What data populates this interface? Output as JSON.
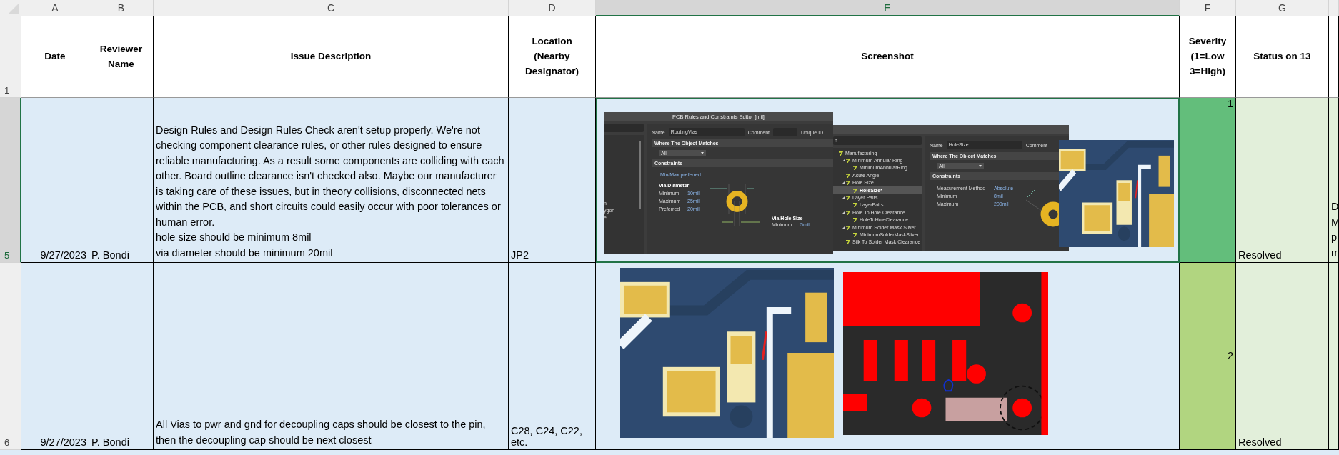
{
  "columns": [
    {
      "letter": "A",
      "selected": false
    },
    {
      "letter": "B",
      "selected": false
    },
    {
      "letter": "C",
      "selected": false
    },
    {
      "letter": "D",
      "selected": false
    },
    {
      "letter": "E",
      "selected": true
    },
    {
      "letter": "F",
      "selected": false
    },
    {
      "letter": "G",
      "selected": false
    }
  ],
  "header_row": {
    "number": "1",
    "cells": [
      "Date",
      "Reviewer Name",
      "Issue Description",
      "Location (Nearby Designator)",
      "Screenshot",
      "Severity (1=Low 3=High)",
      "Status on 13"
    ]
  },
  "rows": [
    {
      "number": "5",
      "selected": true,
      "date": "9/27/2023",
      "reviewer": "P. Bondi",
      "issue": [
        "Design Rules and Design Rules Check aren't setup properly. We're not checking component clearance rules, or other rules designed to ensure reliable manufacturing. As a result some components are colliding with each other. Board outline clearance isn't checked also. Maybe our manufacturer is taking care of these issues, but in theory collisions, disconnected nets within the PCB, and short circuits could easily occur with poor tolerances or human error.",
        "hole size should be minimum 8mil",
        "via diameter should be minimum 20mil"
      ],
      "location": "JP2",
      "severity": "1",
      "color": "#63be7b",
      "status": "Resolved",
      "column_8": [
        "D",
        "M",
        "p",
        "m"
      ],
      "screenshots": [
        {
          "kind": "rules-editor",
          "title": "PCB Rules and Constraints Editor [mil]",
          "left_list": [
            "n",
            "ygon",
            "e"
          ],
          "name_label": "Name",
          "name": "RoutingVias",
          "comment_label": "Comment",
          "unique_id_label": "Unique ID",
          "match_heading": "Where The Object Matches",
          "match_value": "All",
          "constraints_heading": "Constraints",
          "constraint_mode": "Min/Max preferred",
          "via_diameter": {
            "title": "Via Diameter",
            "rows": [
              {
                "label": "Minimum",
                "value": "10mil"
              },
              {
                "label": "Maximum",
                "value": "25mil"
              },
              {
                "label": "Preferred",
                "value": "20mil"
              }
            ]
          },
          "via_hole": {
            "title": "Via Hole Size",
            "rows": [
              {
                "label": "Minimum",
                "value": "5mil"
              }
            ]
          }
        },
        {
          "kind": "rules-editor",
          "search": "h",
          "tree": [
            {
              "label": "Manufacturing",
              "selected": false,
              "children": [
                {
                  "label": "Minimum Annular Ring",
                  "selected": false,
                  "children": [
                    {
                      "label": "MinimumAnnularRing",
                      "selected": false
                    }
                  ]
                },
                {
                  "label": "Acute Angle",
                  "selected": false
                },
                {
                  "label": "Hole Size",
                  "selected": false,
                  "children": [
                    {
                      "label": "HoleSize*",
                      "selected": true
                    }
                  ]
                },
                {
                  "label": "Layer Pairs",
                  "selected": false,
                  "children": [
                    {
                      "label": "LayerPairs",
                      "selected": false
                    }
                  ]
                },
                {
                  "label": "Hole To Hole Clearance",
                  "selected": false,
                  "children": [
                    {
                      "label": "HoleToHoleClearance",
                      "selected": false
                    }
                  ]
                },
                {
                  "label": "Minimum Solder Mask Sliver",
                  "selected": false,
                  "children": [
                    {
                      "label": "MinimumSolderMaskSliver",
                      "selected": false
                    }
                  ]
                },
                {
                  "label": "Silk To Solder Mask Clearance",
                  "selected": false
                }
              ]
            }
          ],
          "name_label": "Name",
          "name": "HoleSize",
          "comment_label": "Comment",
          "match_heading": "Where The Object Matches",
          "match_value": "All",
          "constraints_heading": "Constraints",
          "settings": [
            {
              "label": "Measurement Method",
              "value": "Absolute"
            },
            {
              "label": "Minimum",
              "value": "8mil"
            },
            {
              "label": "Maximum",
              "value": "200mil"
            }
          ]
        },
        {
          "kind": "picture"
        }
      ]
    },
    {
      "number": "6",
      "selected": false,
      "date": "9/27/2023",
      "reviewer": "P. Bondi",
      "issue": [
        "All Vias to pwr and gnd for decoupling caps should be closest to the pin, then the decoupling cap should be next closest"
      ],
      "location": "C28, C24, C22, etc.",
      "severity": "2",
      "color": "#b1d580",
      "status": "Resolved",
      "screenshots": [
        {
          "kind": "picture"
        },
        {
          "kind": "picture"
        }
      ]
    }
  ]
}
